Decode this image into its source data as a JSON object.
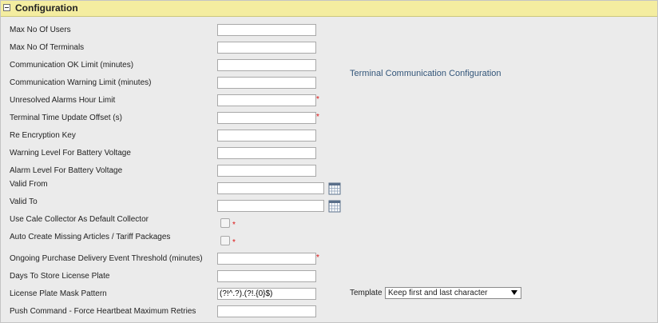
{
  "section": {
    "title": "Configuration"
  },
  "fields": [
    {
      "label": "Max No Of Users",
      "value": ""
    },
    {
      "label": "Max No Of Terminals",
      "value": ""
    },
    {
      "label": "Communication OK Limit (minutes)",
      "value": ""
    },
    {
      "label": "Communication Warning Limit (minutes)",
      "value": ""
    },
    {
      "label": "Unresolved Alarms Hour Limit",
      "value": "",
      "required": "*"
    },
    {
      "label": "Terminal Time Update Offset (s)",
      "value": "",
      "required": "*"
    },
    {
      "label": "Re Encryption Key",
      "value": ""
    },
    {
      "label": "Warning Level For Battery Voltage",
      "value": ""
    },
    {
      "label": "Alarm Level For Battery Voltage",
      "value": ""
    },
    {
      "label": "Valid From",
      "value": ""
    },
    {
      "label": "Valid To",
      "value": ""
    },
    {
      "label": "Use Cale Collector As Default Collector",
      "required": "*"
    },
    {
      "label": "Auto Create Missing Articles / Tariff Packages",
      "required": "*"
    },
    {
      "label": "Ongoing Purchase Delivery Event Threshold (minutes)",
      "value": "",
      "required": "*"
    },
    {
      "label": "Days To Store License Plate",
      "value": ""
    },
    {
      "label": "License Plate Mask Pattern",
      "value": "(?!^.?).(?!.{0}$)"
    },
    {
      "label": "Push Command - Force Heartbeat Maximum Retries",
      "value": ""
    }
  ],
  "terminal_link": "Terminal Communication Configuration",
  "template": {
    "label": "Template",
    "selected": "Keep first and last character"
  },
  "icons": {
    "collapse": "minus-box-icon",
    "calendar": "calendar-icon",
    "dropdown": "triangle-down-icon"
  }
}
